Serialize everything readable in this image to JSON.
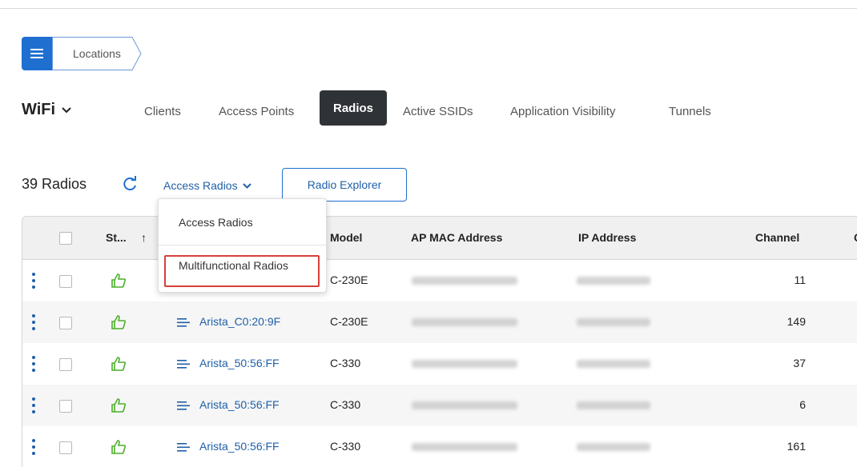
{
  "breadcrumb": {
    "label": "Locations"
  },
  "header": {
    "title": "WiFi",
    "tabs": [
      {
        "label": "Clients",
        "active": false
      },
      {
        "label": "Access Points",
        "active": false
      },
      {
        "label": "Radios",
        "active": true
      },
      {
        "label": "Active SSIDs",
        "active": false
      },
      {
        "label": "Application Visibility",
        "active": false
      },
      {
        "label": "Tunnels",
        "active": false
      }
    ]
  },
  "toolbar": {
    "count_label": "39 Radios",
    "filter_selected": "Access Radios",
    "radio_explorer_label": "Radio Explorer"
  },
  "dropdown": {
    "options": [
      "Access Radios",
      "Multifunctional Radios"
    ],
    "highlighted": "Multifunctional Radios"
  },
  "table": {
    "columns": [
      "St...",
      "Model",
      "AP MAC Address",
      "IP Address",
      "Channel",
      "Cl"
    ],
    "rows": [
      {
        "name": "",
        "model": "C-230E",
        "channel": "11"
      },
      {
        "name": "Arista_C0:20:9F",
        "model": "C-230E",
        "channel": "149"
      },
      {
        "name": "Arista_50:56:FF",
        "model": "C-330",
        "channel": "37"
      },
      {
        "name": "Arista_50:56:FF",
        "model": "C-330",
        "channel": "6"
      },
      {
        "name": "Arista_50:56:FF",
        "model": "C-330",
        "channel": "161"
      }
    ]
  },
  "colors": {
    "accent": "#1f6fd1",
    "active_tab": "#2f3337",
    "status_ok": "#4caf2a",
    "highlight": "#d6403a"
  },
  "icons": {
    "status": "thumbs-up-icon",
    "menu": "hamburger-icon",
    "refresh": "refresh-icon",
    "row_menu": "kebab-icon"
  }
}
